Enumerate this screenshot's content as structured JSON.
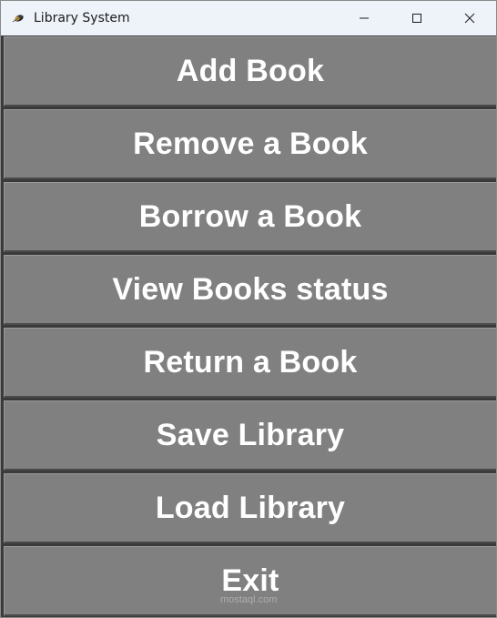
{
  "window": {
    "title": "Library System",
    "icon": "feather-icon"
  },
  "menu": {
    "buttons": [
      {
        "label": "Add Book"
      },
      {
        "label": "Remove a Book"
      },
      {
        "label": "Borrow a Book"
      },
      {
        "label": "View Books status"
      },
      {
        "label": "Return a Book"
      },
      {
        "label": "Save Library"
      },
      {
        "label": "Load Library"
      },
      {
        "label": "Exit"
      }
    ]
  },
  "watermark": "mostaql.com",
  "colors": {
    "button_bg": "#808080",
    "button_text": "#ffffff",
    "titlebar_bg": "#eef3f9"
  }
}
